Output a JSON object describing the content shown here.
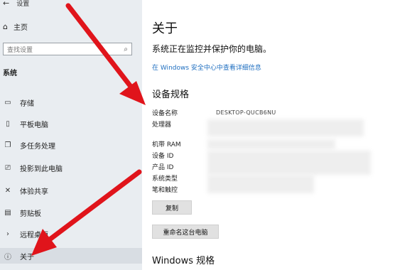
{
  "sidebar": {
    "back_label": "←",
    "settings_label": "设置",
    "home_label": "主页",
    "search_placeholder": "查找设置",
    "section_title": "系统",
    "items": [
      {
        "label": "存储",
        "icon": "storage-icon"
      },
      {
        "label": "平板电脑",
        "icon": "tablet-icon"
      },
      {
        "label": "多任务处理",
        "icon": "multitasking-icon"
      },
      {
        "label": "投影到此电脑",
        "icon": "projecting-icon"
      },
      {
        "label": "体验共享",
        "icon": "shared-experiences-icon"
      },
      {
        "label": "剪贴板",
        "icon": "clipboard-icon"
      },
      {
        "label": "远程桌面",
        "icon": "remote-desktop-icon"
      },
      {
        "label": "关于",
        "icon": "info-icon",
        "active": true
      }
    ]
  },
  "main": {
    "title": "关于",
    "protect_text": "系统正在监控并保护你的电脑。",
    "security_link": "在 Windows 安全中心中查看详细信息",
    "spec_title": "设备规格",
    "spec_labels": [
      "设备名称",
      "处理器",
      "机带 RAM",
      "设备 ID",
      "产品 ID",
      "系统类型",
      "笔和触控"
    ],
    "device_name_value": "DESKTOP-QUCB6NU",
    "copy_button": "复制",
    "rename_button": "重命名这台电脑",
    "windows_spec_title": "Windows 规格"
  },
  "colors": {
    "sidebar_bg": "#e9edf1",
    "link": "#1f6fc0",
    "arrow": "#e0141b"
  }
}
